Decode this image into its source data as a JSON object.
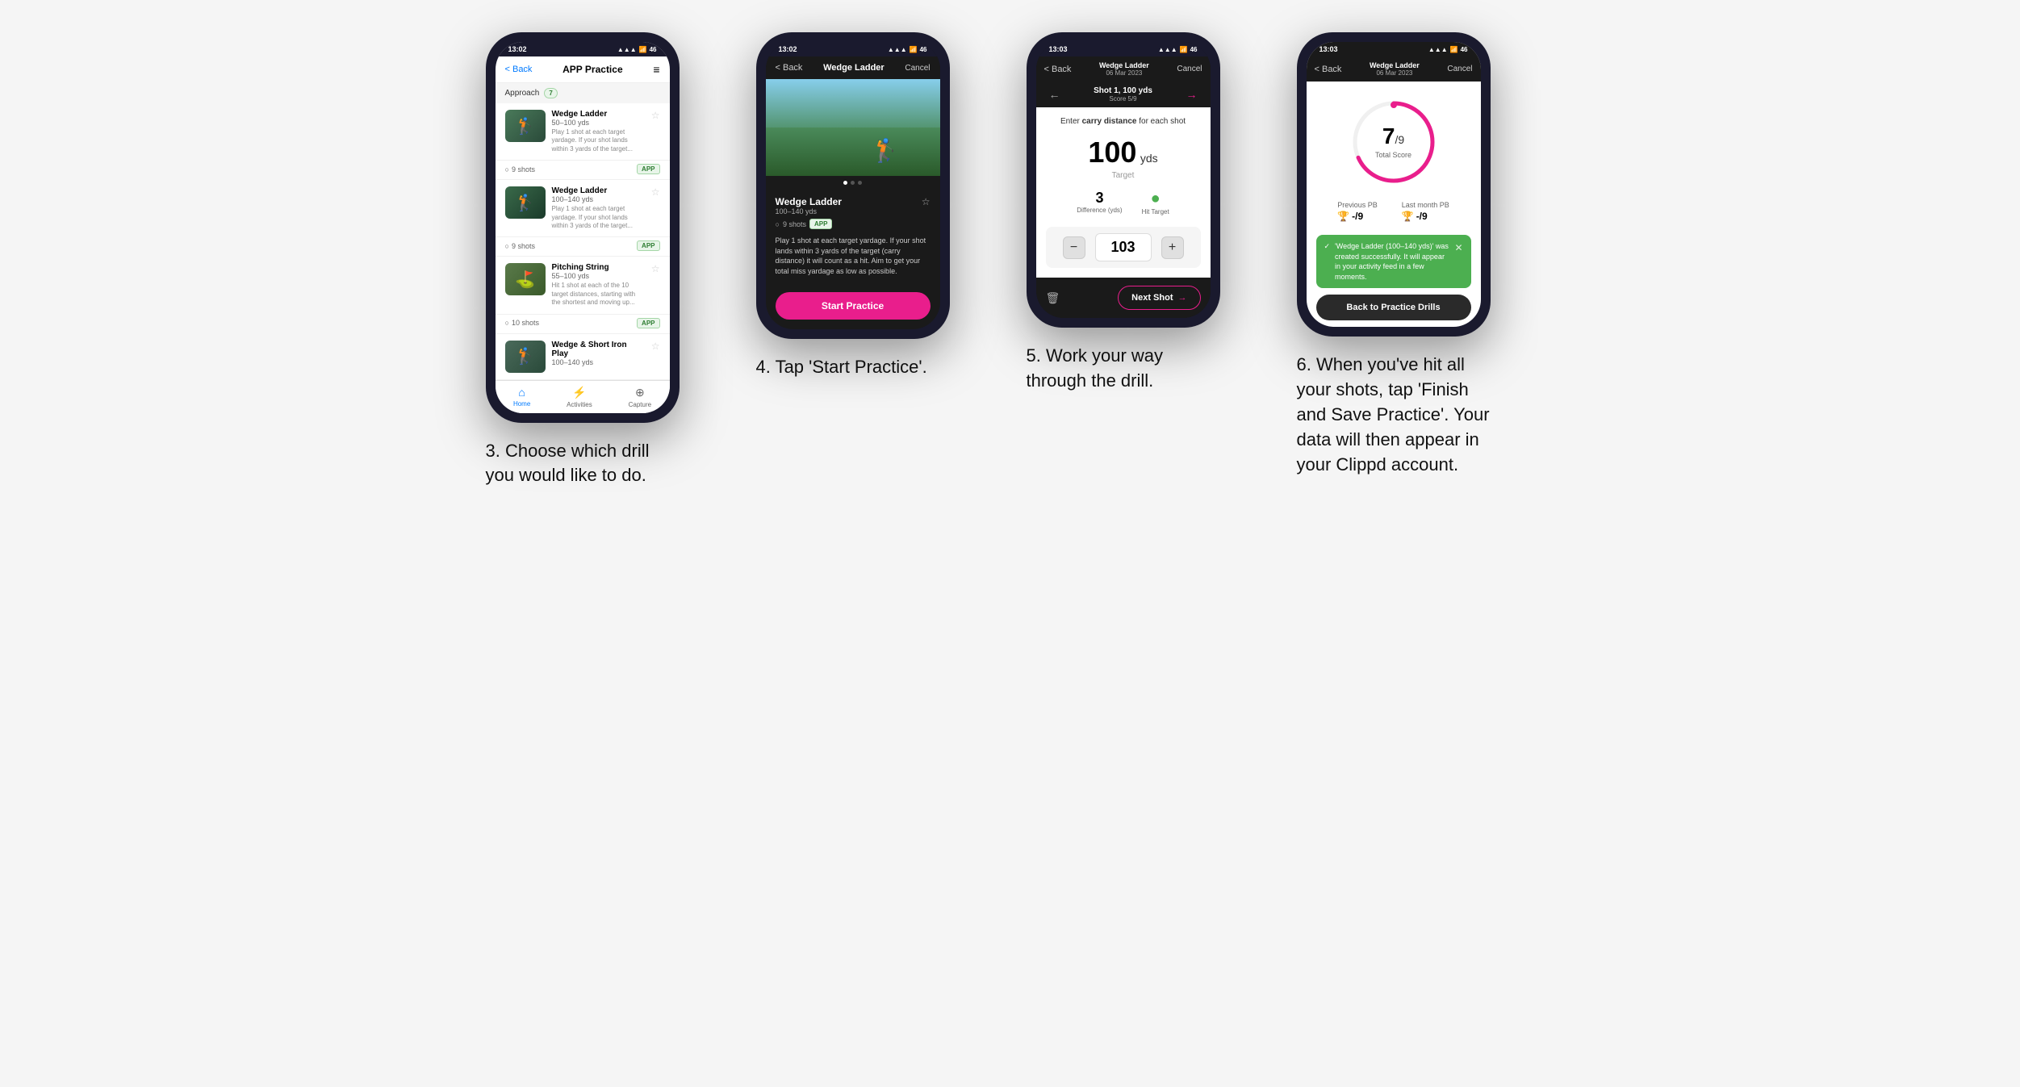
{
  "phones": [
    {
      "id": "phone1",
      "time": "13:02",
      "nav": {
        "back": "< Back",
        "title": "APP Practice",
        "menu": "≡"
      },
      "section": "Approach",
      "section_badge": "7",
      "drills": [
        {
          "name": "Wedge Ladder",
          "yds": "50–100 yds",
          "desc": "Play 1 shot at each target yardage. If your shot lands within 3 yards of the target...",
          "shots": "9 shots",
          "badge": "APP"
        },
        {
          "name": "Wedge Ladder",
          "yds": "100–140 yds",
          "desc": "Play 1 shot at each target yardage. If your shot lands within 3 yards of the target...",
          "shots": "9 shots",
          "badge": "APP"
        },
        {
          "name": "Pitching String",
          "yds": "55–100 yds",
          "desc": "Hit 1 shot at each of the 10 target distances, starting with the shortest and moving up...",
          "shots": "10 shots",
          "badge": "APP"
        },
        {
          "name": "Wedge & Short Iron Play",
          "yds": "100–140 yds",
          "shots": "",
          "desc": "",
          "badge": ""
        }
      ],
      "bottom_nav": [
        "Home",
        "Activities",
        "Capture"
      ]
    },
    {
      "id": "phone2",
      "time": "13:02",
      "nav": {
        "back": "< Back",
        "title": "Wedge Ladder",
        "cancel": "Cancel"
      },
      "drill": {
        "name": "Wedge Ladder",
        "yds": "100–140 yds",
        "shots": "9 shots",
        "badge": "APP",
        "desc": "Play 1 shot at each target yardage. If your shot lands within 3 yards of the target (carry distance) it will count as a hit. Aim to get your total miss yardage as low as possible."
      },
      "start_btn": "Start Practice"
    },
    {
      "id": "phone3",
      "time": "13:03",
      "nav": {
        "back": "< Back",
        "subtitle": "Wedge Ladder",
        "date": "06 Mar 2023",
        "cancel": "Cancel"
      },
      "shot_nav": {
        "prev_arrow": "←",
        "next_arrow": "→",
        "title": "Shot 1, 100 yds",
        "score": "Score 5/9"
      },
      "carry_label": "Enter carry distance for each shot",
      "target_yds": "100",
      "target_unit": "yds",
      "target_label": "Target",
      "difference_val": "3",
      "difference_label": "Difference (yds)",
      "hit_target_label": "Hit Target",
      "input_value": "103",
      "minus_btn": "−",
      "plus_btn": "+",
      "next_shot_btn": "Next Shot"
    },
    {
      "id": "phone4",
      "time": "13:03",
      "nav": {
        "back": "< Back",
        "subtitle": "Wedge Ladder",
        "date": "06 Mar 2023",
        "cancel": "Cancel"
      },
      "score_num": "7",
      "score_denom": "/9",
      "score_label": "Total Score",
      "previous_pb_label": "Previous PB",
      "previous_pb_val": "-/9",
      "last_month_pb_label": "Last month PB",
      "last_month_pb_val": "-/9",
      "toast_msg": "'Wedge Ladder (100–140 yds)' was created successfully. It will appear in your activity feed in a few moments.",
      "back_to_drills_btn": "Back to Practice Drills"
    }
  ],
  "captions": [
    "3. Choose which drill you would like to do.",
    "4. Tap 'Start Practice'.",
    "5. Work your way through the drill.",
    "6. When you've hit all your shots, tap 'Finish and Save Practice'. Your data will then appear in your Clippd account."
  ]
}
